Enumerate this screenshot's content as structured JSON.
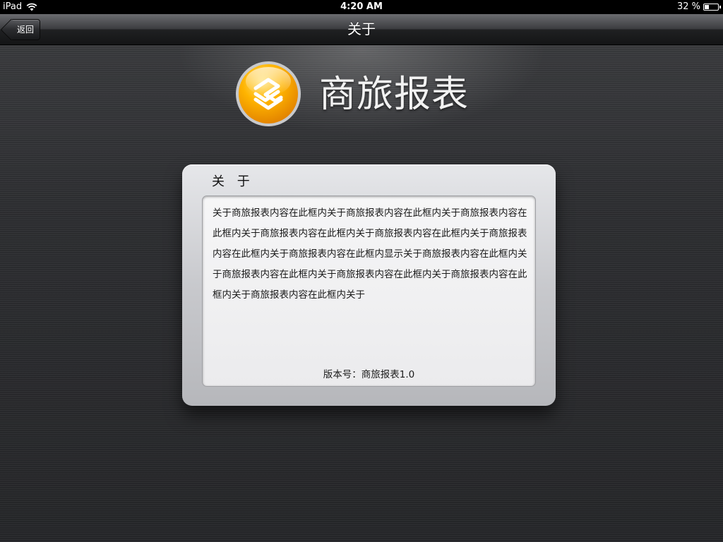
{
  "status_bar": {
    "device": "iPad",
    "time": "4:20 AM",
    "battery_percent": "32 %",
    "battery_level": 0.32,
    "wifi_icon": "wifi-icon",
    "battery_icon": "battery-icon"
  },
  "nav": {
    "title": "关于",
    "back_label": "返回"
  },
  "header": {
    "logo_icon": "china-mobile-logo-icon",
    "app_name": "商旅报表",
    "logo_color": "#f5a300"
  },
  "about": {
    "title": "关 于",
    "content": "关于商旅报表内容在此框内关于商旅报表内容在此框内关于商旅报表内容在此框内关于商旅报表内容在此框内关于商旅报表内容在此框内关于商旅报表内容在此框内关于商旅报表内容在此框内显示关于商旅报表内容在此框内关于商旅报表内容在此框内关于商旅报表内容在此框内关于商旅报表内容在此框内关于商旅报表内容在此框内关于",
    "version": "版本号：商旅报表1.0"
  }
}
